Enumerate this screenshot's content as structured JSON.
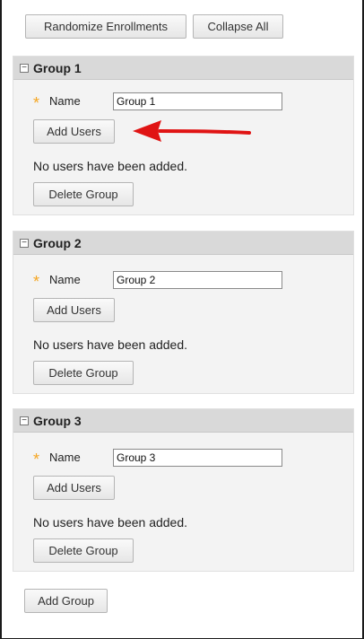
{
  "toolbar": {
    "randomize_label": "Randomize Enrollments",
    "collapse_label": "Collapse All"
  },
  "groups": [
    {
      "title": "Group 1",
      "name_label": "Name",
      "name_value": "Group 1",
      "add_users_label": "Add Users",
      "empty_message": "No users have been added.",
      "delete_label": "Delete Group"
    },
    {
      "title": "Group 2",
      "name_label": "Name",
      "name_value": "Group 2",
      "add_users_label": "Add Users",
      "empty_message": "No users have been added.",
      "delete_label": "Delete Group"
    },
    {
      "title": "Group 3",
      "name_label": "Name",
      "name_value": "Group 3",
      "add_users_label": "Add Users",
      "empty_message": "No users have been added.",
      "delete_label": "Delete Group"
    }
  ],
  "footer": {
    "add_group_label": "Add Group"
  },
  "icons": {
    "required": "asterisk-icon",
    "collapse": "minus-box-icon",
    "annotation": "red-arrow-icon"
  },
  "colors": {
    "required_star": "#f5a623",
    "arrow": "#e01414",
    "section_header": "#d9d9d9"
  }
}
